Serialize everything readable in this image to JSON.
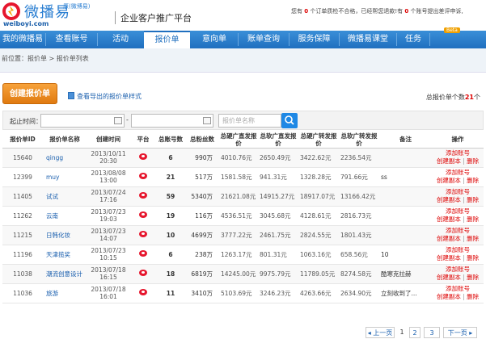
{
  "header": {
    "logo_cn": "微播易",
    "logo_sub": "原(微博易)",
    "logo_url": "weiboyi.com",
    "platform": "企业客户推广平台",
    "notice_pre": "您有",
    "notice_count1": "0",
    "notice_mid": "个订单质检不合格，已经帮您退款!有",
    "notice_count2": "0",
    "notice_post": "个账号提出差评申诉,"
  },
  "nav": {
    "items": [
      "我的微播易",
      "查看账号",
      "活动",
      "报价单",
      "意向单",
      "账单查询",
      "服务保障",
      "微播易课堂",
      "任务"
    ],
    "active": "报价单",
    "beta": "Beta"
  },
  "breadcrumb": "前位置：报价单 > 报价单列表",
  "toolbar": {
    "create_label": "创建报价单",
    "export_label": "查看导出的报价单样式",
    "total_pre": "总报价单个数",
    "total_num": "21",
    "total_post": "个"
  },
  "filter": {
    "start_label": "起止时间：",
    "dash": "-",
    "search_placeholder": "报价单名称"
  },
  "table": {
    "headers": [
      "报价单ID",
      "报价单名称",
      "创建时间",
      "平台",
      "总账号数",
      "总粉丝数",
      "总硬广直发报价",
      "总软广直发报价",
      "总硬广转发报价",
      "总软广转发报价",
      "备注",
      "操作"
    ],
    "rows": [
      {
        "id": "15640",
        "name": "qingg",
        "date": "2013/10/11",
        "time": "20:30",
        "accounts": "6",
        "fans": "990万",
        "p1": "4010.76元",
        "p2": "2650.49元",
        "p3": "3422.62元",
        "p4": "2236.54元",
        "note": ""
      },
      {
        "id": "12399",
        "name": "muy",
        "date": "2013/08/08",
        "time": "13:00",
        "accounts": "21",
        "fans": "517万",
        "p1": "1581.58元",
        "p2": "941.31元",
        "p3": "1328.28元",
        "p4": "791.66元",
        "note": "ss"
      },
      {
        "id": "11405",
        "name": "试试",
        "date": "2013/07/24",
        "time": "17:16",
        "accounts": "59",
        "fans": "5340万",
        "p1": "21621.08元",
        "p2": "14915.27元",
        "p3": "18917.07元",
        "p4": "13166.42元",
        "note": ""
      },
      {
        "id": "11262",
        "name": "云南",
        "date": "2013/07/23",
        "time": "19:03",
        "accounts": "19",
        "fans": "116万",
        "p1": "4536.51元",
        "p2": "3045.68元",
        "p3": "4128.61元",
        "p4": "2816.73元",
        "note": ""
      },
      {
        "id": "11215",
        "name": "日韩化妆",
        "date": "2013/07/23",
        "time": "14:07",
        "accounts": "10",
        "fans": "4699万",
        "p1": "3777.22元",
        "p2": "2461.75元",
        "p3": "2824.55元",
        "p4": "1801.43元",
        "note": ""
      },
      {
        "id": "11196",
        "name": "天津揽奖",
        "date": "2013/07/23",
        "time": "10:15",
        "accounts": "6",
        "fans": "238万",
        "p1": "1263.17元",
        "p2": "801.31元",
        "p3": "1063.16元",
        "p4": "658.56元",
        "note": "10"
      },
      {
        "id": "11038",
        "name": "潮流创意设计",
        "date": "2013/07/18",
        "time": "16:15",
        "accounts": "18",
        "fans": "6819万",
        "p1": "14245.00元",
        "p2": "9975.79元",
        "p3": "11789.05元",
        "p4": "8274.58元",
        "note": "酷寒克拉赫"
      },
      {
        "id": "11036",
        "name": "旅游",
        "date": "2013/07/18",
        "time": "16:01",
        "accounts": "11",
        "fans": "3410万",
        "p1": "5103.69元",
        "p2": "3246.23元",
        "p3": "4263.66元",
        "p4": "2634.90元",
        "note": "立刻收到了..."
      }
    ],
    "op_add": "添加账号",
    "op_copy": "创建副本",
    "op_sep": "|",
    "op_delete": "删除"
  },
  "pager": {
    "prev": "上一页",
    "pages": [
      "1",
      "2",
      "3"
    ],
    "next": "下一页"
  },
  "colors": {
    "nav_blue": "#1f6fbf",
    "accent_orange": "#e88a20",
    "link_blue": "#1a5fae",
    "red": "#dd0000"
  }
}
